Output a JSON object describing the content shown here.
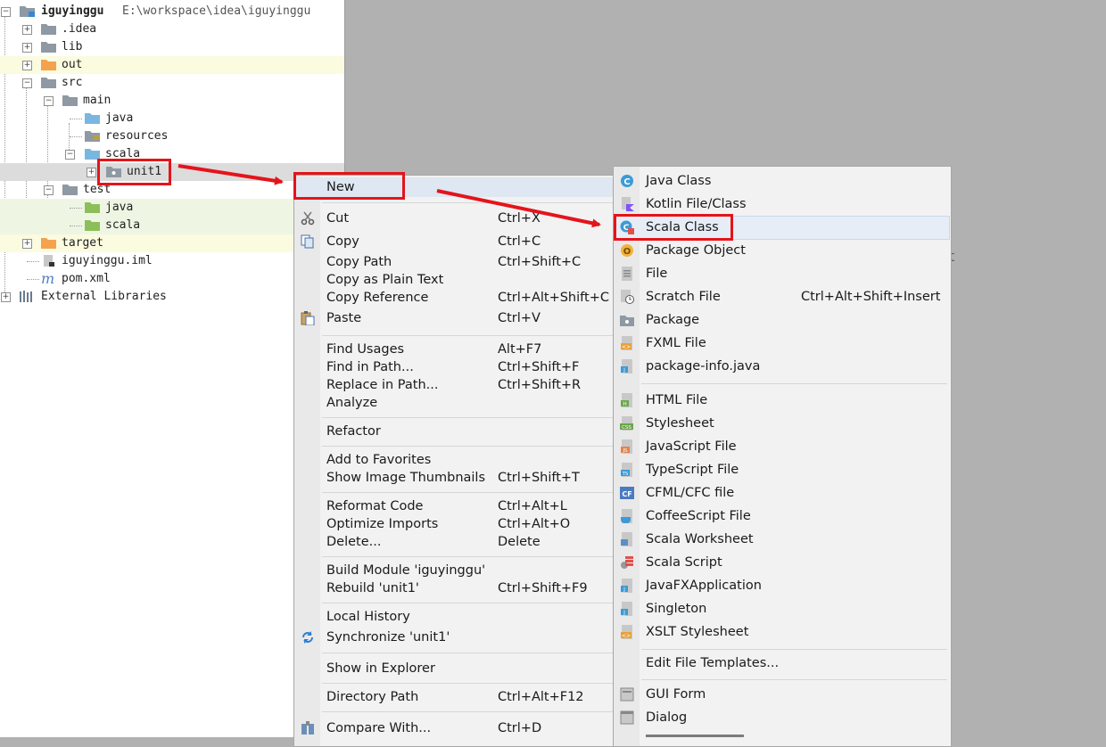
{
  "project_tree": {
    "root": {
      "label": "iguyinggu",
      "path": "E:\\workspace\\idea\\iguyinggu"
    },
    "items": [
      {
        "label": ".idea"
      },
      {
        "label": "lib"
      },
      {
        "label": "out"
      },
      {
        "label": "src"
      },
      {
        "label": "main"
      },
      {
        "label": "java"
      },
      {
        "label": "resources"
      },
      {
        "label": "scala"
      },
      {
        "label": "unit1"
      },
      {
        "label": "test"
      },
      {
        "label": "java"
      },
      {
        "label": "scala"
      },
      {
        "label": "target"
      },
      {
        "label": "iguyinggu.iml"
      },
      {
        "label": "pom.xml"
      },
      {
        "label": "External Libraries"
      }
    ]
  },
  "context_menu": {
    "items": [
      {
        "label": "New",
        "shortcut": ""
      },
      {
        "label": "Cut",
        "shortcut": "Ctrl+X"
      },
      {
        "label": "Copy",
        "shortcut": "Ctrl+C"
      },
      {
        "label": "Copy Path",
        "shortcut": "Ctrl+Shift+C"
      },
      {
        "label": "Copy as Plain Text",
        "shortcut": ""
      },
      {
        "label": "Copy Reference",
        "shortcut": "Ctrl+Alt+Shift+C"
      },
      {
        "label": "Paste",
        "shortcut": "Ctrl+V"
      },
      {
        "label": "Find Usages",
        "shortcut": "Alt+F7"
      },
      {
        "label": "Find in Path...",
        "shortcut": "Ctrl+Shift+F"
      },
      {
        "label": "Replace in Path...",
        "shortcut": "Ctrl+Shift+R"
      },
      {
        "label": "Analyze",
        "shortcut": ""
      },
      {
        "label": "Refactor",
        "shortcut": ""
      },
      {
        "label": "Add to Favorites",
        "shortcut": ""
      },
      {
        "label": "Show Image Thumbnails",
        "shortcut": "Ctrl+Shift+T"
      },
      {
        "label": "Reformat Code",
        "shortcut": "Ctrl+Alt+L"
      },
      {
        "label": "Optimize Imports",
        "shortcut": "Ctrl+Alt+O"
      },
      {
        "label": "Delete...",
        "shortcut": "Delete"
      },
      {
        "label": "Build Module 'iguyinggu'",
        "shortcut": ""
      },
      {
        "label": "Rebuild 'unit1'",
        "shortcut": "Ctrl+Shift+F9"
      },
      {
        "label": "Local History",
        "shortcut": ""
      },
      {
        "label": "Synchronize 'unit1'",
        "shortcut": ""
      },
      {
        "label": "Show in Explorer",
        "shortcut": ""
      },
      {
        "label": "Directory Path",
        "shortcut": "Ctrl+Alt+F12"
      },
      {
        "label": "Compare With...",
        "shortcut": "Ctrl+D"
      }
    ]
  },
  "new_submenu": {
    "items": [
      {
        "label": "Java Class",
        "shortcut": "",
        "icon": "java-class-icon"
      },
      {
        "label": "Kotlin File/Class",
        "shortcut": "",
        "icon": "kotlin-icon"
      },
      {
        "label": "Scala Class",
        "shortcut": "",
        "icon": "scala-class-icon"
      },
      {
        "label": "Package Object",
        "shortcut": "",
        "icon": "package-object-icon"
      },
      {
        "label": "File",
        "shortcut": "",
        "icon": "file-icon"
      },
      {
        "label": "Scratch File",
        "shortcut": "Ctrl+Alt+Shift+Insert",
        "icon": "scratch-file-icon"
      },
      {
        "label": "Package",
        "shortcut": "",
        "icon": "package-icon"
      },
      {
        "label": "FXML File",
        "shortcut": "",
        "icon": "fxml-icon"
      },
      {
        "label": "package-info.java",
        "shortcut": "",
        "icon": "java-file-icon"
      },
      {
        "label": "HTML File",
        "shortcut": "",
        "icon": "html-icon"
      },
      {
        "label": "Stylesheet",
        "shortcut": "",
        "icon": "css-icon"
      },
      {
        "label": "JavaScript File",
        "shortcut": "",
        "icon": "js-icon"
      },
      {
        "label": "TypeScript File",
        "shortcut": "",
        "icon": "ts-icon"
      },
      {
        "label": "CFML/CFC file",
        "shortcut": "",
        "icon": "cf-icon"
      },
      {
        "label": "CoffeeScript File",
        "shortcut": "",
        "icon": "coffee-icon"
      },
      {
        "label": "Scala Worksheet",
        "shortcut": "",
        "icon": "scala-worksheet-icon"
      },
      {
        "label": "Scala Script",
        "shortcut": "",
        "icon": "scala-script-icon"
      },
      {
        "label": "JavaFXApplication",
        "shortcut": "",
        "icon": "javafx-icon"
      },
      {
        "label": "Singleton",
        "shortcut": "",
        "icon": "singleton-icon"
      },
      {
        "label": "XSLT Stylesheet",
        "shortcut": "",
        "icon": "xslt-icon"
      },
      {
        "label": "Edit File Templates...",
        "shortcut": "",
        "icon": ""
      },
      {
        "label": "GUI Form",
        "shortcut": "",
        "icon": "gui-form-icon"
      },
      {
        "label": "Dialog",
        "shortcut": "",
        "icon": "dialog-icon"
      }
    ]
  },
  "editor_fragment": {
    "text": "t"
  },
  "colors": {
    "highlight": "#e4141b",
    "folder_gray": "#8f99a3",
    "folder_blue": "#7ab7e0",
    "folder_green": "#8cbf5a",
    "folder_orange": "#f4a24e"
  }
}
